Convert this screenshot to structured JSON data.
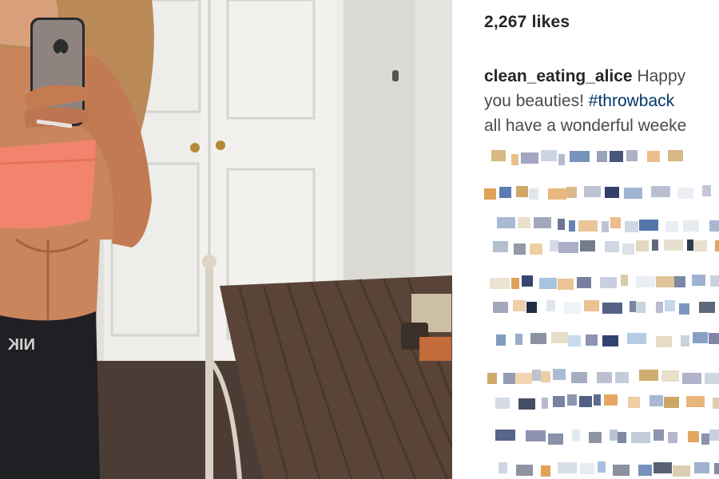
{
  "post": {
    "likes_text": "2,267 likes",
    "caption": {
      "username": "clean_eating_alice",
      "line1_text": " Happy",
      "line2_text": "you beauties! ",
      "hashtag": "#throwback",
      "line3_text": "all have a wonderful weeke"
    }
  },
  "comments": {
    "state": "pixelated",
    "count": 14
  },
  "colors": {
    "text_primary": "#262626",
    "text_secondary": "#4a4a4a",
    "link": "#003569",
    "background": "#ffffff"
  },
  "icons": [
    "apple-logo-icon"
  ]
}
